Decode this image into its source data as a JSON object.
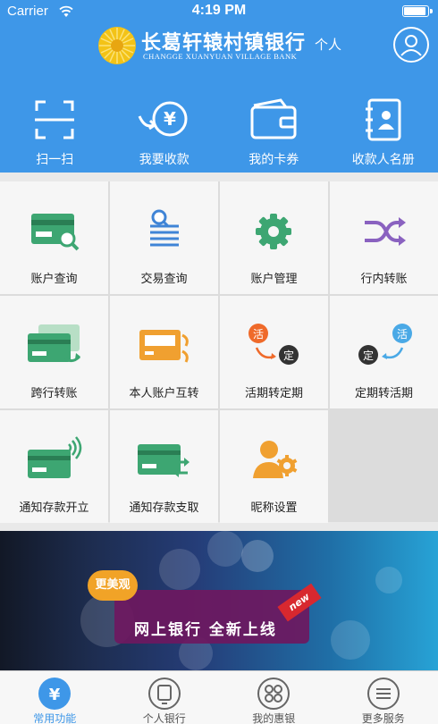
{
  "status_bar": {
    "carrier": "Carrier",
    "time": "4:19 PM",
    "battery_level": 0.95
  },
  "header": {
    "bank_name": "长葛轩辕村镇银行",
    "bank_name_en": "CHANGGE XUANYUAN VILLAGE BANK",
    "mode": "个人"
  },
  "quick_actions": [
    {
      "label": "扫一扫",
      "icon": "scan-icon"
    },
    {
      "label": "我要收款",
      "icon": "receive-money-icon"
    },
    {
      "label": "我的卡券",
      "icon": "wallet-icon"
    },
    {
      "label": "收款人名册",
      "icon": "contacts-book-icon"
    }
  ],
  "functions": [
    {
      "label": "账户查询",
      "icon": "account-query-icon"
    },
    {
      "label": "交易查询",
      "icon": "transaction-query-icon"
    },
    {
      "label": "账户管理",
      "icon": "gear-icon"
    },
    {
      "label": "行内转账",
      "icon": "shuffle-icon"
    },
    {
      "label": "跨行转账",
      "icon": "interbank-transfer-icon"
    },
    {
      "label": "本人账户互转",
      "icon": "own-transfer-icon"
    },
    {
      "label": "活期转定期",
      "icon": "current-to-fixed-icon",
      "badge_a": "活",
      "badge_b": "定"
    },
    {
      "label": "定期转活期",
      "icon": "fixed-to-current-icon",
      "badge_a": "定",
      "badge_b": "活"
    },
    {
      "label": "通知存款开立",
      "icon": "notice-deposit-open-icon"
    },
    {
      "label": "通知存款支取",
      "icon": "notice-deposit-withdraw-icon"
    },
    {
      "label": "昵称设置",
      "icon": "nickname-settings-icon"
    }
  ],
  "banner": {
    "slogan": "更美观",
    "text": "网上银行 全新上线",
    "tag": "new"
  },
  "tabs": [
    {
      "label": "常用功能",
      "icon": "yuan-icon",
      "active": true
    },
    {
      "label": "个人银行",
      "icon": "personal-bank-icon",
      "active": false
    },
    {
      "label": "我的惠银",
      "icon": "grid-icon",
      "active": false
    },
    {
      "label": "更多服务",
      "icon": "menu-icon",
      "active": false
    }
  ],
  "colors": {
    "brand_blue": "#3e97e8",
    "green": "#3da672",
    "orange": "#f0a030",
    "purple": "#8a62c0",
    "icon_blue": "#3f84d6"
  }
}
